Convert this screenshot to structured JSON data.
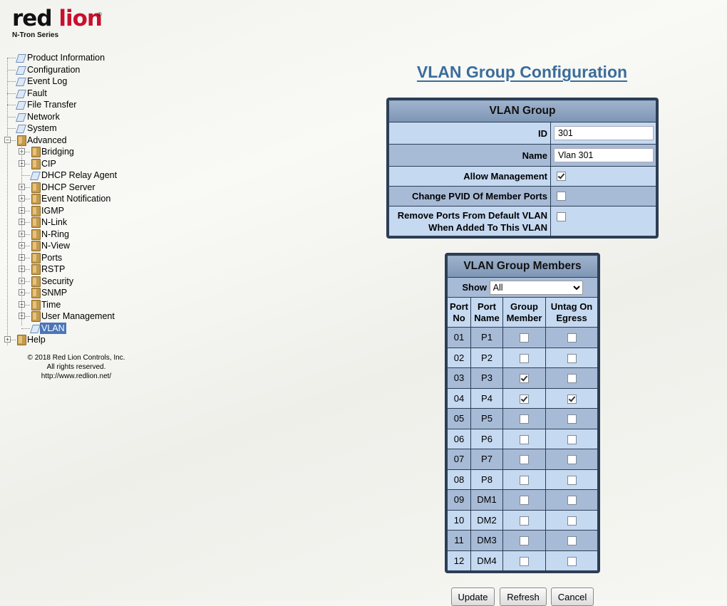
{
  "logo": {
    "brand_red": "red",
    "brand_lion": "lion",
    "reg": "®",
    "series": "N-Tron Series"
  },
  "nav": {
    "items": [
      {
        "label": "Product Information"
      },
      {
        "label": "Configuration"
      },
      {
        "label": "Event Log"
      },
      {
        "label": "Fault"
      },
      {
        "label": "File Transfer"
      },
      {
        "label": "Network"
      },
      {
        "label": "System"
      },
      {
        "label": "Advanced",
        "expanded": true,
        "children": [
          {
            "label": "Bridging"
          },
          {
            "label": "CIP"
          },
          {
            "label": "DHCP Relay Agent"
          },
          {
            "label": "DHCP Server"
          },
          {
            "label": "Event Notification"
          },
          {
            "label": "IGMP"
          },
          {
            "label": "N-Link"
          },
          {
            "label": "N-Ring"
          },
          {
            "label": "N-View"
          },
          {
            "label": "Ports"
          },
          {
            "label": "RSTP"
          },
          {
            "label": "Security"
          },
          {
            "label": "SNMP"
          },
          {
            "label": "Time"
          },
          {
            "label": "User Management"
          },
          {
            "label": "VLAN",
            "selected": true
          }
        ]
      },
      {
        "label": "Help"
      }
    ],
    "footer": [
      "© 2018 Red Lion Controls, Inc.",
      "All rights reserved.",
      "http://www.redlion.net/"
    ]
  },
  "page": {
    "title": "VLAN Group Configuration"
  },
  "vlan_group": {
    "heading": "VLAN Group",
    "id_label": "ID",
    "id_value": "301",
    "name_label": "Name",
    "name_value": "Vlan 301",
    "allow_mgmt_label": "Allow Management",
    "allow_mgmt": true,
    "change_pvid_label": "Change PVID Of Member Ports",
    "change_pvid": false,
    "remove_ports_label_1": "Remove Ports From Default VLAN",
    "remove_ports_label_2": "When Added To This VLAN",
    "remove_ports": false
  },
  "members": {
    "heading": "VLAN Group Members",
    "show_label": "Show",
    "show_value": "All",
    "columns": [
      "Port No",
      "Port Name",
      "Group Member",
      "Untag On Egress"
    ],
    "col_lines": [
      [
        "Port",
        "No"
      ],
      [
        "Port",
        "Name"
      ],
      [
        "Group",
        "Member"
      ],
      [
        "Untag On",
        "Egress"
      ]
    ],
    "rows": [
      {
        "no": "01",
        "name": "P1",
        "member": false,
        "untag": false
      },
      {
        "no": "02",
        "name": "P2",
        "member": false,
        "untag": false
      },
      {
        "no": "03",
        "name": "P3",
        "member": true,
        "untag": false
      },
      {
        "no": "04",
        "name": "P4",
        "member": true,
        "untag": true
      },
      {
        "no": "05",
        "name": "P5",
        "member": false,
        "untag": false
      },
      {
        "no": "06",
        "name": "P6",
        "member": false,
        "untag": false
      },
      {
        "no": "07",
        "name": "P7",
        "member": false,
        "untag": false
      },
      {
        "no": "08",
        "name": "P8",
        "member": false,
        "untag": false
      },
      {
        "no": "09",
        "name": "DM1",
        "member": false,
        "untag": false
      },
      {
        "no": "10",
        "name": "DM2",
        "member": false,
        "untag": false
      },
      {
        "no": "11",
        "name": "DM3",
        "member": false,
        "untag": false
      },
      {
        "no": "12",
        "name": "DM4",
        "member": false,
        "untag": false
      }
    ]
  },
  "buttons": {
    "update": "Update",
    "refresh": "Refresh",
    "cancel": "Cancel"
  }
}
